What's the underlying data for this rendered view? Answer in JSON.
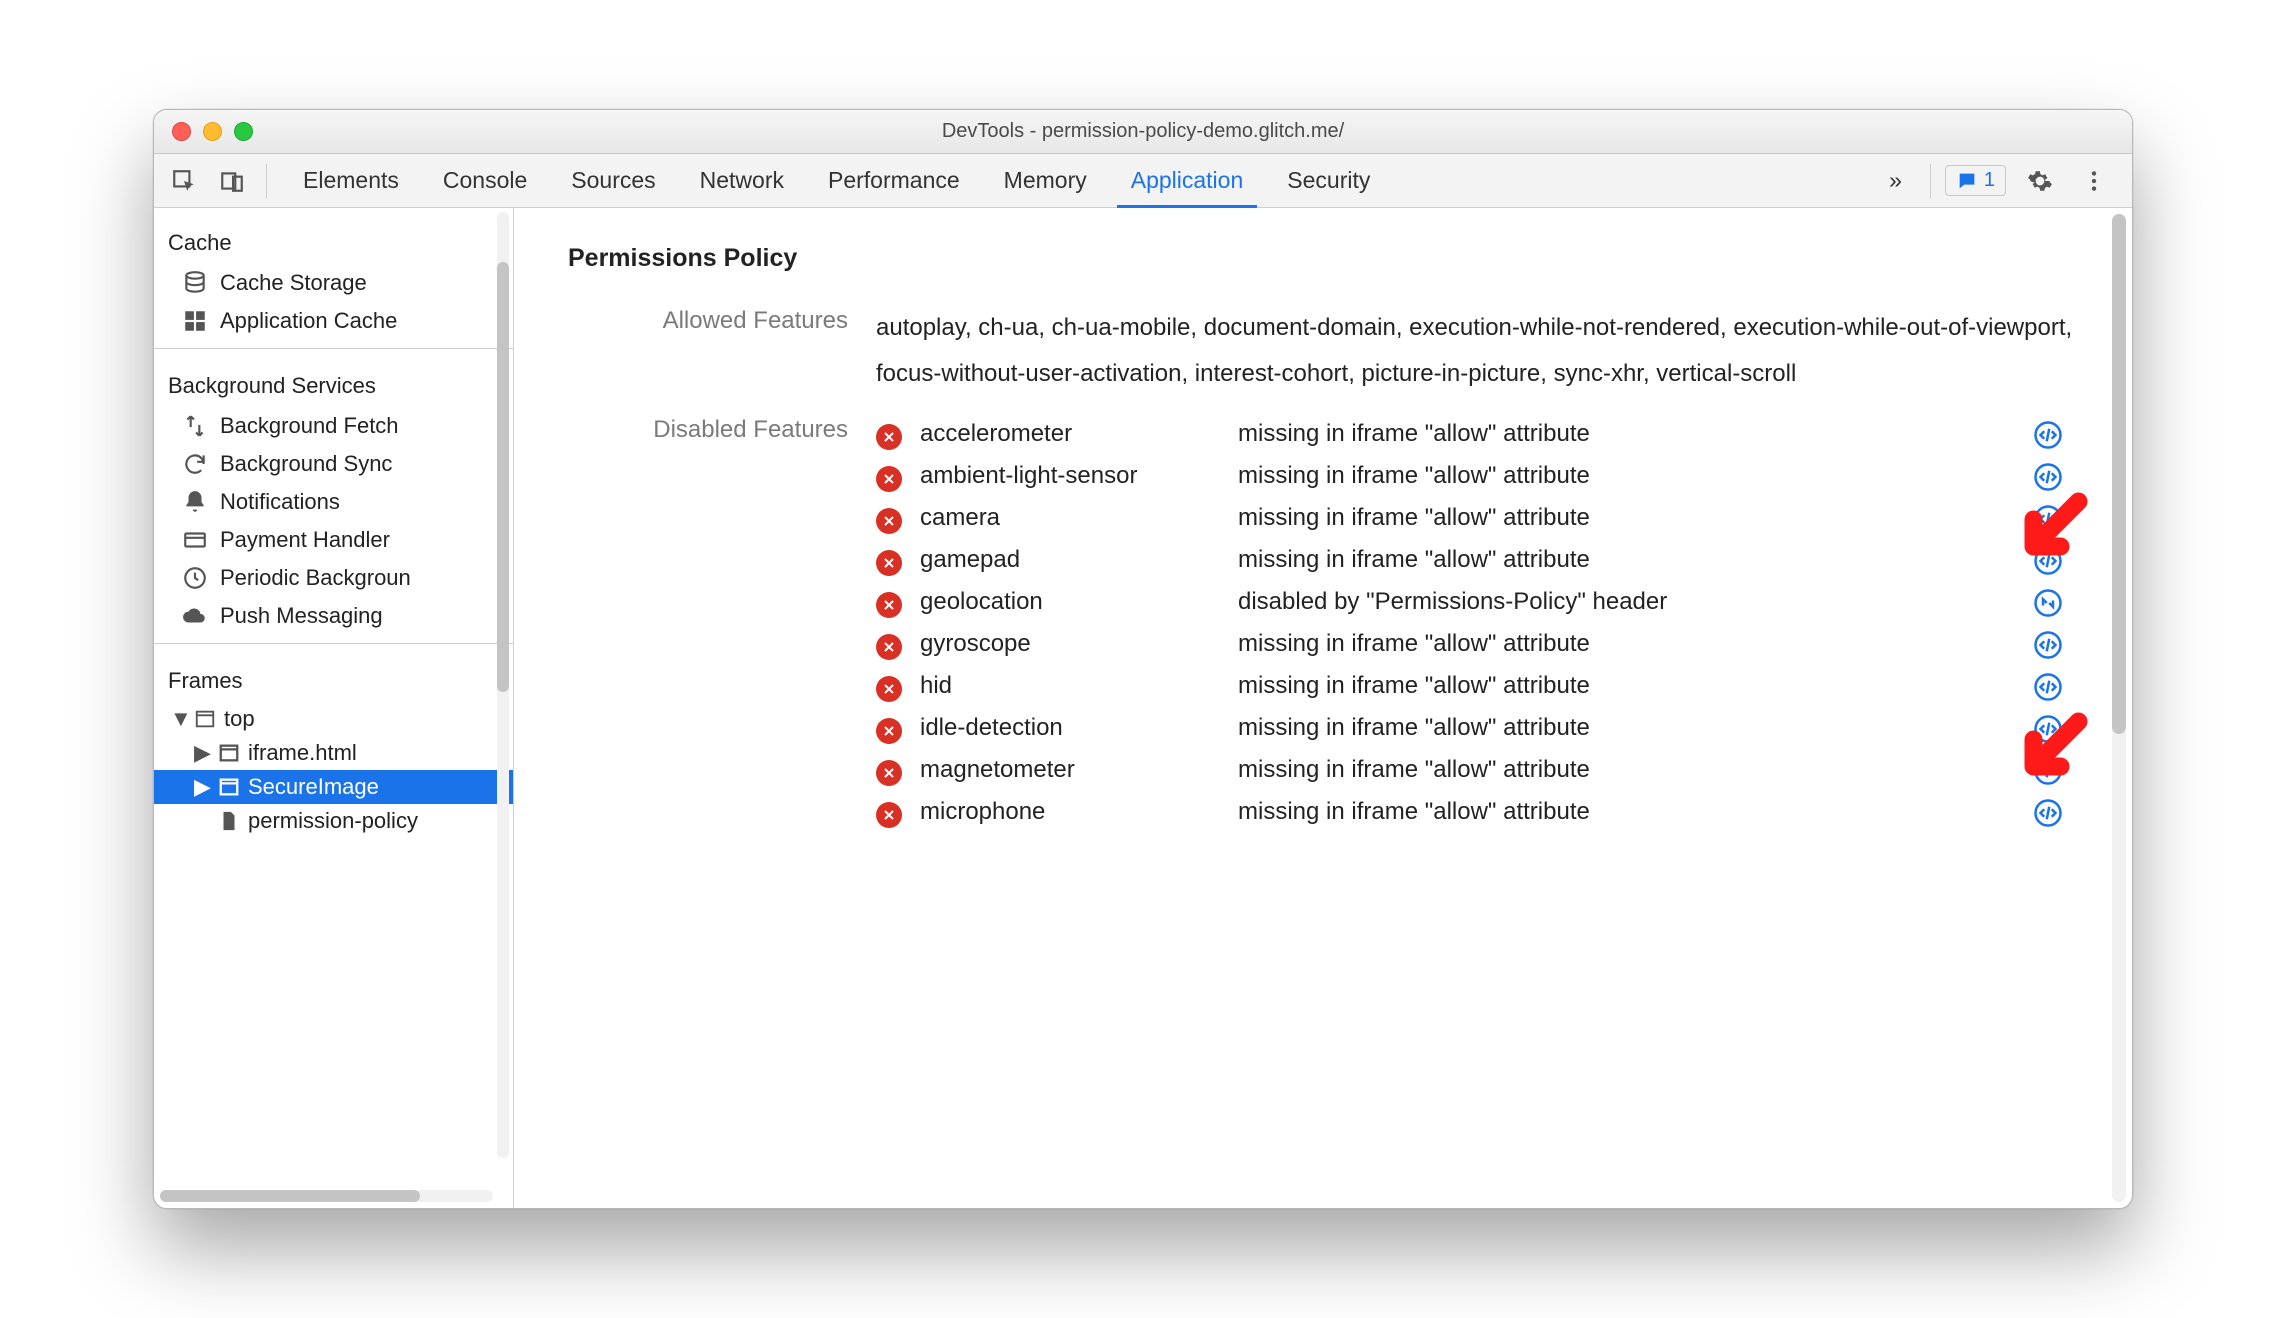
{
  "window": {
    "title": "DevTools - permission-policy-demo.glitch.me/"
  },
  "toolbar": {
    "tabs": [
      "Elements",
      "Console",
      "Sources",
      "Network",
      "Performance",
      "Memory",
      "Application",
      "Security"
    ],
    "active_tab_index": 6,
    "overflow_label": "»",
    "issues_count": "1"
  },
  "sidebar": {
    "sections": [
      {
        "title": "Cache",
        "items": [
          {
            "icon": "database-icon",
            "label": "Cache Storage"
          },
          {
            "icon": "tiles-icon",
            "label": "Application Cache"
          }
        ]
      },
      {
        "title": "Background Services",
        "items": [
          {
            "icon": "fetch-icon",
            "label": "Background Fetch"
          },
          {
            "icon": "sync-icon",
            "label": "Background Sync"
          },
          {
            "icon": "bell-icon",
            "label": "Notifications"
          },
          {
            "icon": "card-icon",
            "label": "Payment Handler"
          },
          {
            "icon": "clock-icon",
            "label": "Periodic Backgroun"
          },
          {
            "icon": "cloud-icon",
            "label": "Push Messaging"
          }
        ]
      },
      {
        "title": "Frames",
        "tree": {
          "root": {
            "icon": "window-icon",
            "label": "top",
            "expanded": true,
            "children": [
              {
                "icon": "iframe-icon",
                "label": "iframe.html",
                "has_children": true
              },
              {
                "icon": "iframe-icon",
                "label": "SecureImage",
                "has_children": true,
                "selected": true
              },
              {
                "icon": "file-icon",
                "label": "permission-policy"
              }
            ]
          }
        }
      }
    ]
  },
  "main": {
    "title": "Permissions Policy",
    "allowed_label": "Allowed Features",
    "allowed_value": "autoplay, ch-ua, ch-ua-mobile, document-domain, execution-while-not-rendered, execution-while-out-of-viewport, focus-without-user-activation, interest-cohort, picture-in-picture, sync-xhr, vertical-scroll",
    "disabled_label": "Disabled Features",
    "disabled_features": [
      {
        "name": "accelerometer",
        "reason": "missing in iframe \"allow\" attribute",
        "link": "code"
      },
      {
        "name": "ambient-light-sensor",
        "reason": "missing in iframe \"allow\" attribute",
        "link": "code"
      },
      {
        "name": "camera",
        "reason": "missing in iframe \"allow\" attribute",
        "link": "code"
      },
      {
        "name": "gamepad",
        "reason": "missing in iframe \"allow\" attribute",
        "link": "code"
      },
      {
        "name": "geolocation",
        "reason": "disabled by \"Permissions-Policy\" header",
        "link": "network"
      },
      {
        "name": "gyroscope",
        "reason": "missing in iframe \"allow\" attribute",
        "link": "code"
      },
      {
        "name": "hid",
        "reason": "missing in iframe \"allow\" attribute",
        "link": "code"
      },
      {
        "name": "idle-detection",
        "reason": "missing in iframe \"allow\" attribute",
        "link": "code"
      },
      {
        "name": "magnetometer",
        "reason": "missing in iframe \"allow\" attribute",
        "link": "code"
      },
      {
        "name": "microphone",
        "reason": "missing in iframe \"allow\" attribute",
        "link": "code"
      }
    ]
  }
}
